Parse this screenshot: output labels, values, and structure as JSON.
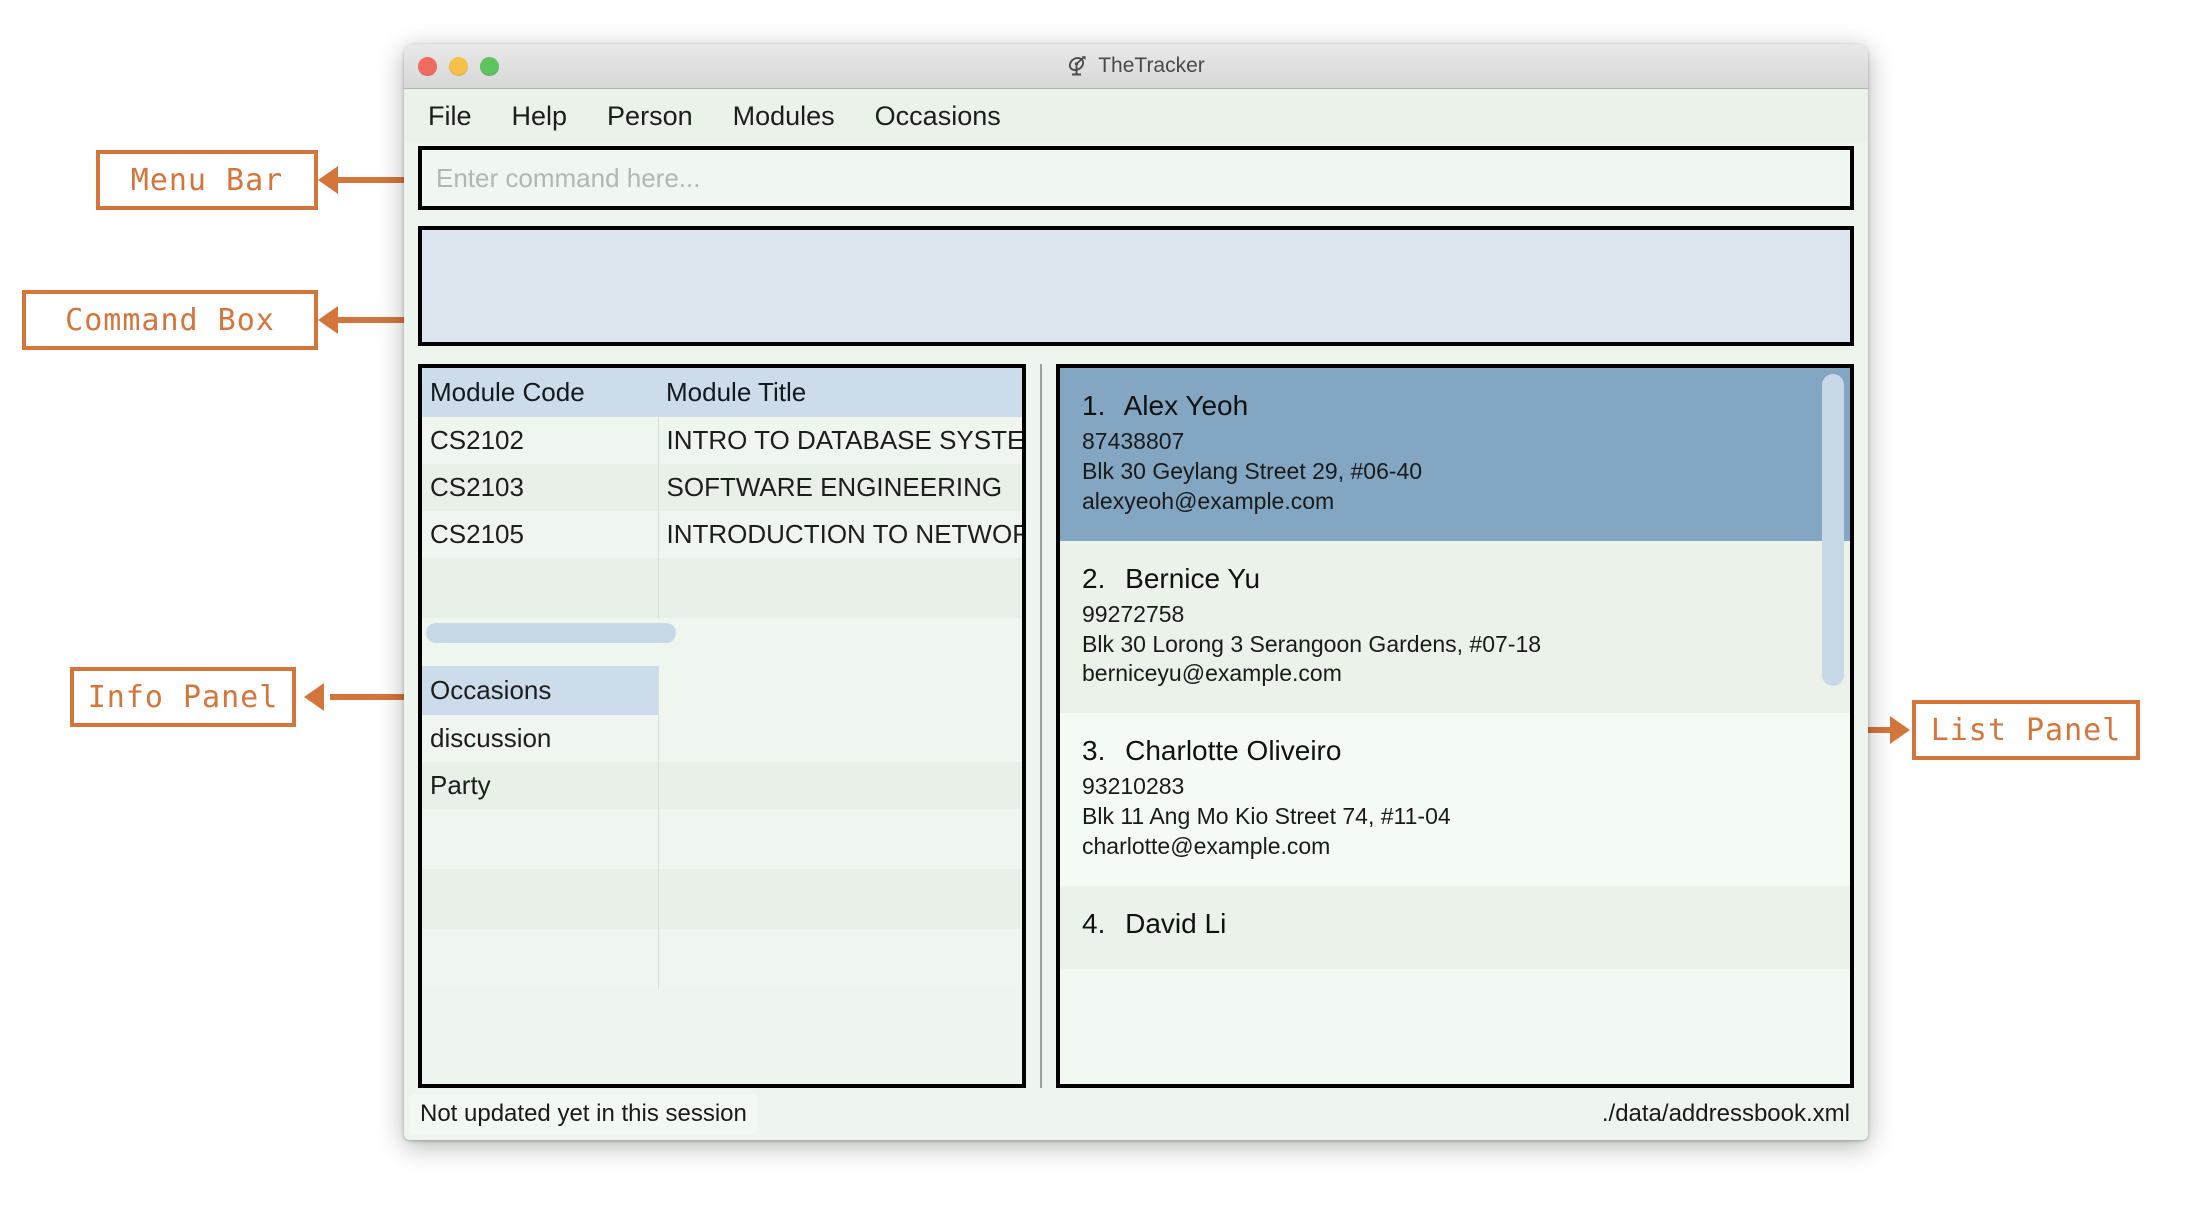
{
  "window": {
    "title": "TheTracker",
    "icon": "satellite-dish-icon",
    "controls": {
      "close": "close",
      "minimize": "minimize",
      "maximize": "maximize"
    }
  },
  "menubar": {
    "items": [
      {
        "label": "File"
      },
      {
        "label": "Help"
      },
      {
        "label": "Person"
      },
      {
        "label": "Modules"
      },
      {
        "label": "Occasions"
      }
    ]
  },
  "command_box": {
    "placeholder": "Enter command here...",
    "value": ""
  },
  "result_display": {
    "text": ""
  },
  "info_panel": {
    "modules_table": {
      "columns": [
        "Module Code",
        "Module Title"
      ],
      "rows": [
        {
          "code": "CS2102",
          "title": "INTRO TO DATABASE SYSTEMS"
        },
        {
          "code": "CS2103",
          "title": "SOFTWARE ENGINEERING"
        },
        {
          "code": "CS2105",
          "title": "INTRODUCTION TO NETWORKS"
        }
      ],
      "empty_rows": 1,
      "hscrollbar": true
    },
    "occasions_table": {
      "columns": [
        "Occasions"
      ],
      "rows": [
        {
          "name": "discussion"
        },
        {
          "name": "Party"
        }
      ],
      "empty_rows": 3
    }
  },
  "list_panel": {
    "persons": [
      {
        "index": "1.",
        "name": "Alex Yeoh",
        "phone": "87438807",
        "address": "Blk 30 Geylang Street 29, #06-40",
        "email": "alexyeoh@example.com",
        "selected": true
      },
      {
        "index": "2.",
        "name": "Bernice Yu",
        "phone": "99272758",
        "address": "Blk 30 Lorong 3 Serangoon Gardens, #07-18",
        "email": "berniceyu@example.com",
        "selected": false
      },
      {
        "index": "3.",
        "name": "Charlotte Oliveiro",
        "phone": "93210283",
        "address": "Blk 11 Ang Mo Kio Street 74, #11-04",
        "email": "charlotte@example.com",
        "selected": false
      },
      {
        "index": "4.",
        "name": "David Li",
        "phone": "",
        "address": "",
        "email": "",
        "selected": false
      }
    ],
    "scrollbar": "vertical-scrollbar"
  },
  "status_bar": {
    "left": "Not updated yet in this session",
    "right": "./data/addressbook.xml"
  },
  "annotations": {
    "accent_color": "#d4763c",
    "menu_bar": "Menu  Bar",
    "command_box": "Command  Box",
    "info_panel": "Info Panel",
    "list_panel": "List  Panel"
  }
}
